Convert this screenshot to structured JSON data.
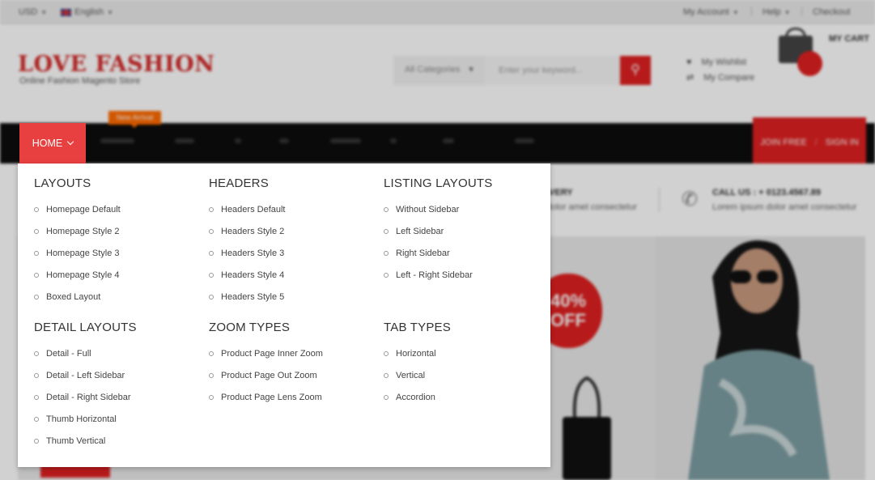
{
  "topbar": {
    "currency": "USD",
    "language": "English",
    "my_account": "My Account",
    "help": "Help",
    "checkout": "Checkout"
  },
  "header": {
    "logo": "LOVE FASHION",
    "tagline": "Online Fashion Magento Store",
    "search_category": "All Categories",
    "search_placeholder": "Enter your keyword...",
    "wishlist": "My Wishlist",
    "compare": "My Compare",
    "cart": "MY CART"
  },
  "nav": {
    "active": "HOME",
    "badge": "New Arrival",
    "join": "JOIN FREE",
    "sign_in": "SIGN IN"
  },
  "features": {
    "delivery_title": "IVERY",
    "delivery_sub": "dolor amet consectetur",
    "call_title": "CALL US : + 0123.4567.89",
    "call_sub": "Lorem ipsum dolor amet consectetur"
  },
  "hero": {
    "badge_line1": "40%",
    "badge_line2": "OFF"
  },
  "menu": {
    "columns": [
      {
        "title": "LAYOUTS",
        "items": [
          "Homepage Default",
          "Homepage Style 2",
          "Homepage Style 3",
          "Homepage Style 4",
          "Boxed Layout"
        ]
      },
      {
        "title": "HEADERS",
        "items": [
          "Headers Default",
          "Headers Style 2",
          "Headers Style 3",
          "Headers Style 4",
          "Headers Style 5"
        ]
      },
      {
        "title": "LISTING LAYOUTS",
        "items": [
          "Without Sidebar",
          "Left Sidebar",
          "Right Sidebar",
          "Left - Right Sidebar"
        ]
      },
      {
        "title": "DETAIL LAYOUTS",
        "items": [
          "Detail - Full",
          "Detail - Left Sidebar",
          "Detail - Right Sidebar",
          "Thumb Horizontal",
          "Thumb Vertical"
        ]
      },
      {
        "title": "ZOOM TYPES",
        "items": [
          "Product Page Inner Zoom",
          "Product Page Out Zoom",
          "Product Page Lens Zoom"
        ]
      },
      {
        "title": "TAB TYPES",
        "items": [
          "Horizontal",
          "Vertical",
          "Accordion"
        ]
      }
    ]
  },
  "colors": {
    "accent": "#e02020",
    "nav_bg": "#0d0d0d",
    "badge": "#ff6a00"
  }
}
